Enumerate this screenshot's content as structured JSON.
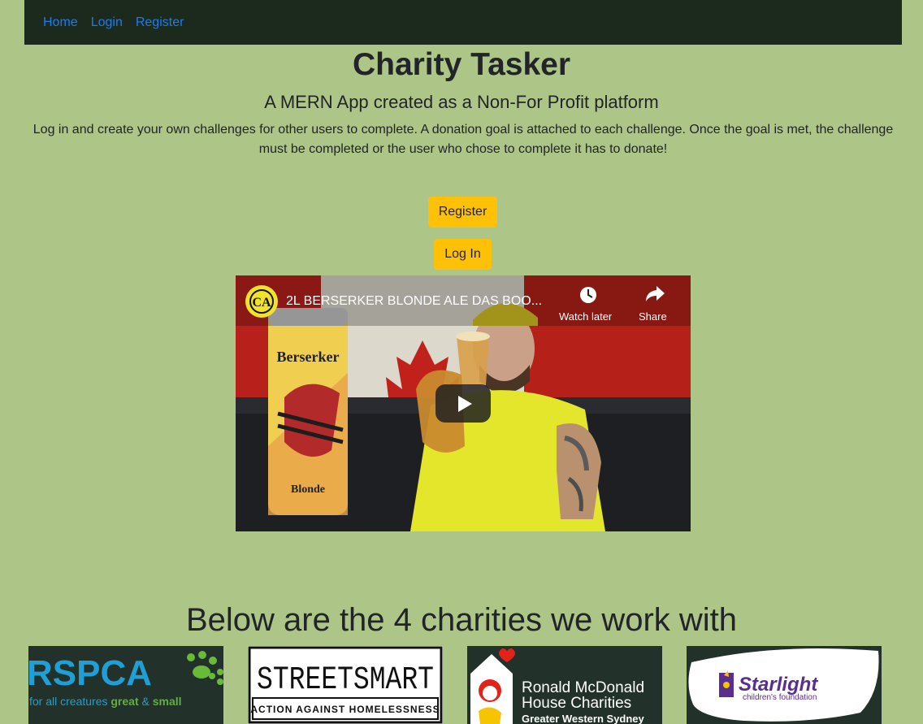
{
  "nav": {
    "items": [
      "Home",
      "Login",
      "Register"
    ]
  },
  "hero": {
    "title": "Charity Tasker",
    "subtitle": "A MERN App created as a Non-For Profit platform",
    "description": "Log in and create your own challenges for other users to complete. A donation goal is attached to each challenge. Once the goal is met, the challenge must be completed or the user who chose to complete it has to donate!"
  },
  "buttons": {
    "register": "Register",
    "login": "Log In"
  },
  "video": {
    "title": "2L BERSERKER BLONDE ALE DAS BOO...",
    "watch_later": "Watch later",
    "share": "Share",
    "channel_logo_text": "CA",
    "can_brand": "Berserker",
    "can_label": "Blonde"
  },
  "charities": {
    "heading": "Below are the 4 charities we work with",
    "logos": [
      {
        "name": "RSPCA",
        "tagline_start": "for all creatures ",
        "tagline_great": "great",
        "tagline_amp": " & ",
        "tagline_small": "small"
      },
      {
        "name": "STREETSMART",
        "tagline": "ACTION AGAINST HOMELESSNESS"
      },
      {
        "line1": "Ronald McDonald",
        "line2": "House Charities",
        "line3": "Greater Western Sydney"
      },
      {
        "name": "Starlight",
        "tagline": "children's foundation"
      }
    ]
  },
  "colors": {
    "background": "#adc587",
    "navbar": "#1c2a1e",
    "nav_link": "#1a7cf0",
    "button": "#ffc107"
  }
}
